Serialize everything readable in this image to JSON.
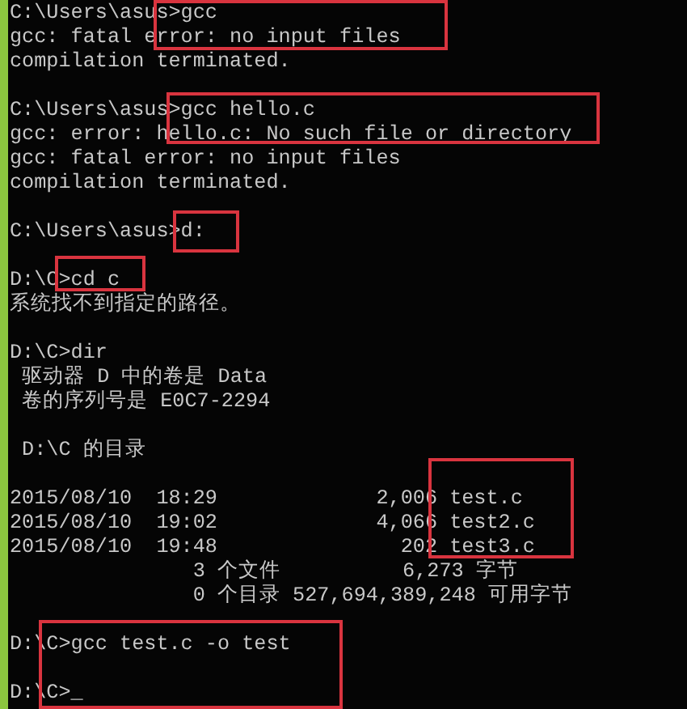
{
  "terminal": {
    "lines": [
      {
        "kind": "text",
        "text": "C:\\Users\\asus>gcc"
      },
      {
        "kind": "text",
        "text": "gcc: fatal error: no input files"
      },
      {
        "kind": "text",
        "text": "compilation terminated."
      },
      {
        "kind": "blank"
      },
      {
        "kind": "text",
        "text": "C:\\Users\\asus>gcc hello.c"
      },
      {
        "kind": "text",
        "text": "gcc: error: hello.c: No such file or directory"
      },
      {
        "kind": "text",
        "text": "gcc: fatal error: no input files"
      },
      {
        "kind": "text",
        "text": "compilation terminated."
      },
      {
        "kind": "blank"
      },
      {
        "kind": "text",
        "text": "C:\\Users\\asus>d:"
      },
      {
        "kind": "blank"
      },
      {
        "kind": "text",
        "text": "D:\\C>cd c"
      },
      {
        "kind": "text",
        "text": "系统找不到指定的路径。"
      },
      {
        "kind": "blank"
      },
      {
        "kind": "text",
        "text": "D:\\C>dir"
      },
      {
        "kind": "text",
        "text": " 驱动器 D 中的卷是 Data"
      },
      {
        "kind": "text",
        "text": " 卷的序列号是 E0C7-2294"
      },
      {
        "kind": "blank"
      },
      {
        "kind": "text",
        "text": " D:\\C 的目录"
      },
      {
        "kind": "blank"
      },
      {
        "kind": "text",
        "text": "2015/08/10  18:29             2,006 test.c"
      },
      {
        "kind": "text",
        "text": "2015/08/10  19:02             4,066 test2.c"
      },
      {
        "kind": "text",
        "text": "2015/08/10  19:48               202 test3.c"
      },
      {
        "kind": "text",
        "text": "               3 个文件          6,273 字节"
      },
      {
        "kind": "text",
        "text": "               0 个目录 527,694,389,248 可用字节"
      },
      {
        "kind": "blank"
      },
      {
        "kind": "text",
        "text": "D:\\C>gcc test.c -o test"
      },
      {
        "kind": "blank"
      },
      {
        "kind": "text",
        "text": "D:\\C>_"
      }
    ]
  }
}
